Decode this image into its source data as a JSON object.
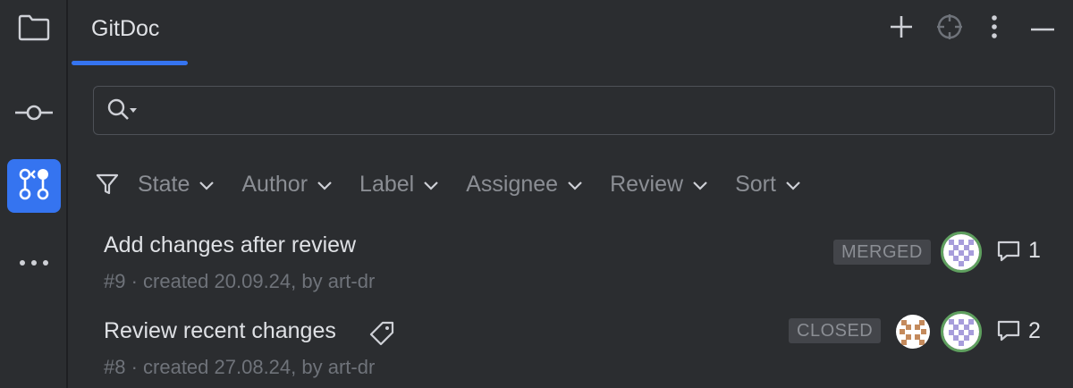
{
  "tool_window": {
    "tab_title": "GitDoc"
  },
  "stripe": {
    "items": [
      {
        "icon": "folder-icon"
      },
      {
        "icon": "commit-icon"
      },
      {
        "icon": "pull-requests-icon"
      },
      {
        "icon": "more-icon"
      }
    ]
  },
  "header_actions": {
    "icons": [
      "plus-icon",
      "crosshair-icon",
      "more-vertical-icon",
      "minimize-icon"
    ]
  },
  "search": {
    "value": "",
    "placeholder": ""
  },
  "filters": {
    "labels": [
      "State",
      "Author",
      "Label",
      "Assignee",
      "Review",
      "Sort"
    ]
  },
  "pull_requests": [
    {
      "title": "Add changes after review",
      "subtitle": "#9 · created 20.09.24, by art-dr",
      "state": "MERGED",
      "comments": "1",
      "has_label_icon": false
    },
    {
      "title": "Review recent changes",
      "subtitle": "#8 · created 27.08.24, by art-dr",
      "state": "CLOSED",
      "comments": "2",
      "has_label_icon": true
    }
  ],
  "colors": {
    "accent": "#3574f0",
    "background": "#2b2d30",
    "badge_bg": "#43454a"
  }
}
